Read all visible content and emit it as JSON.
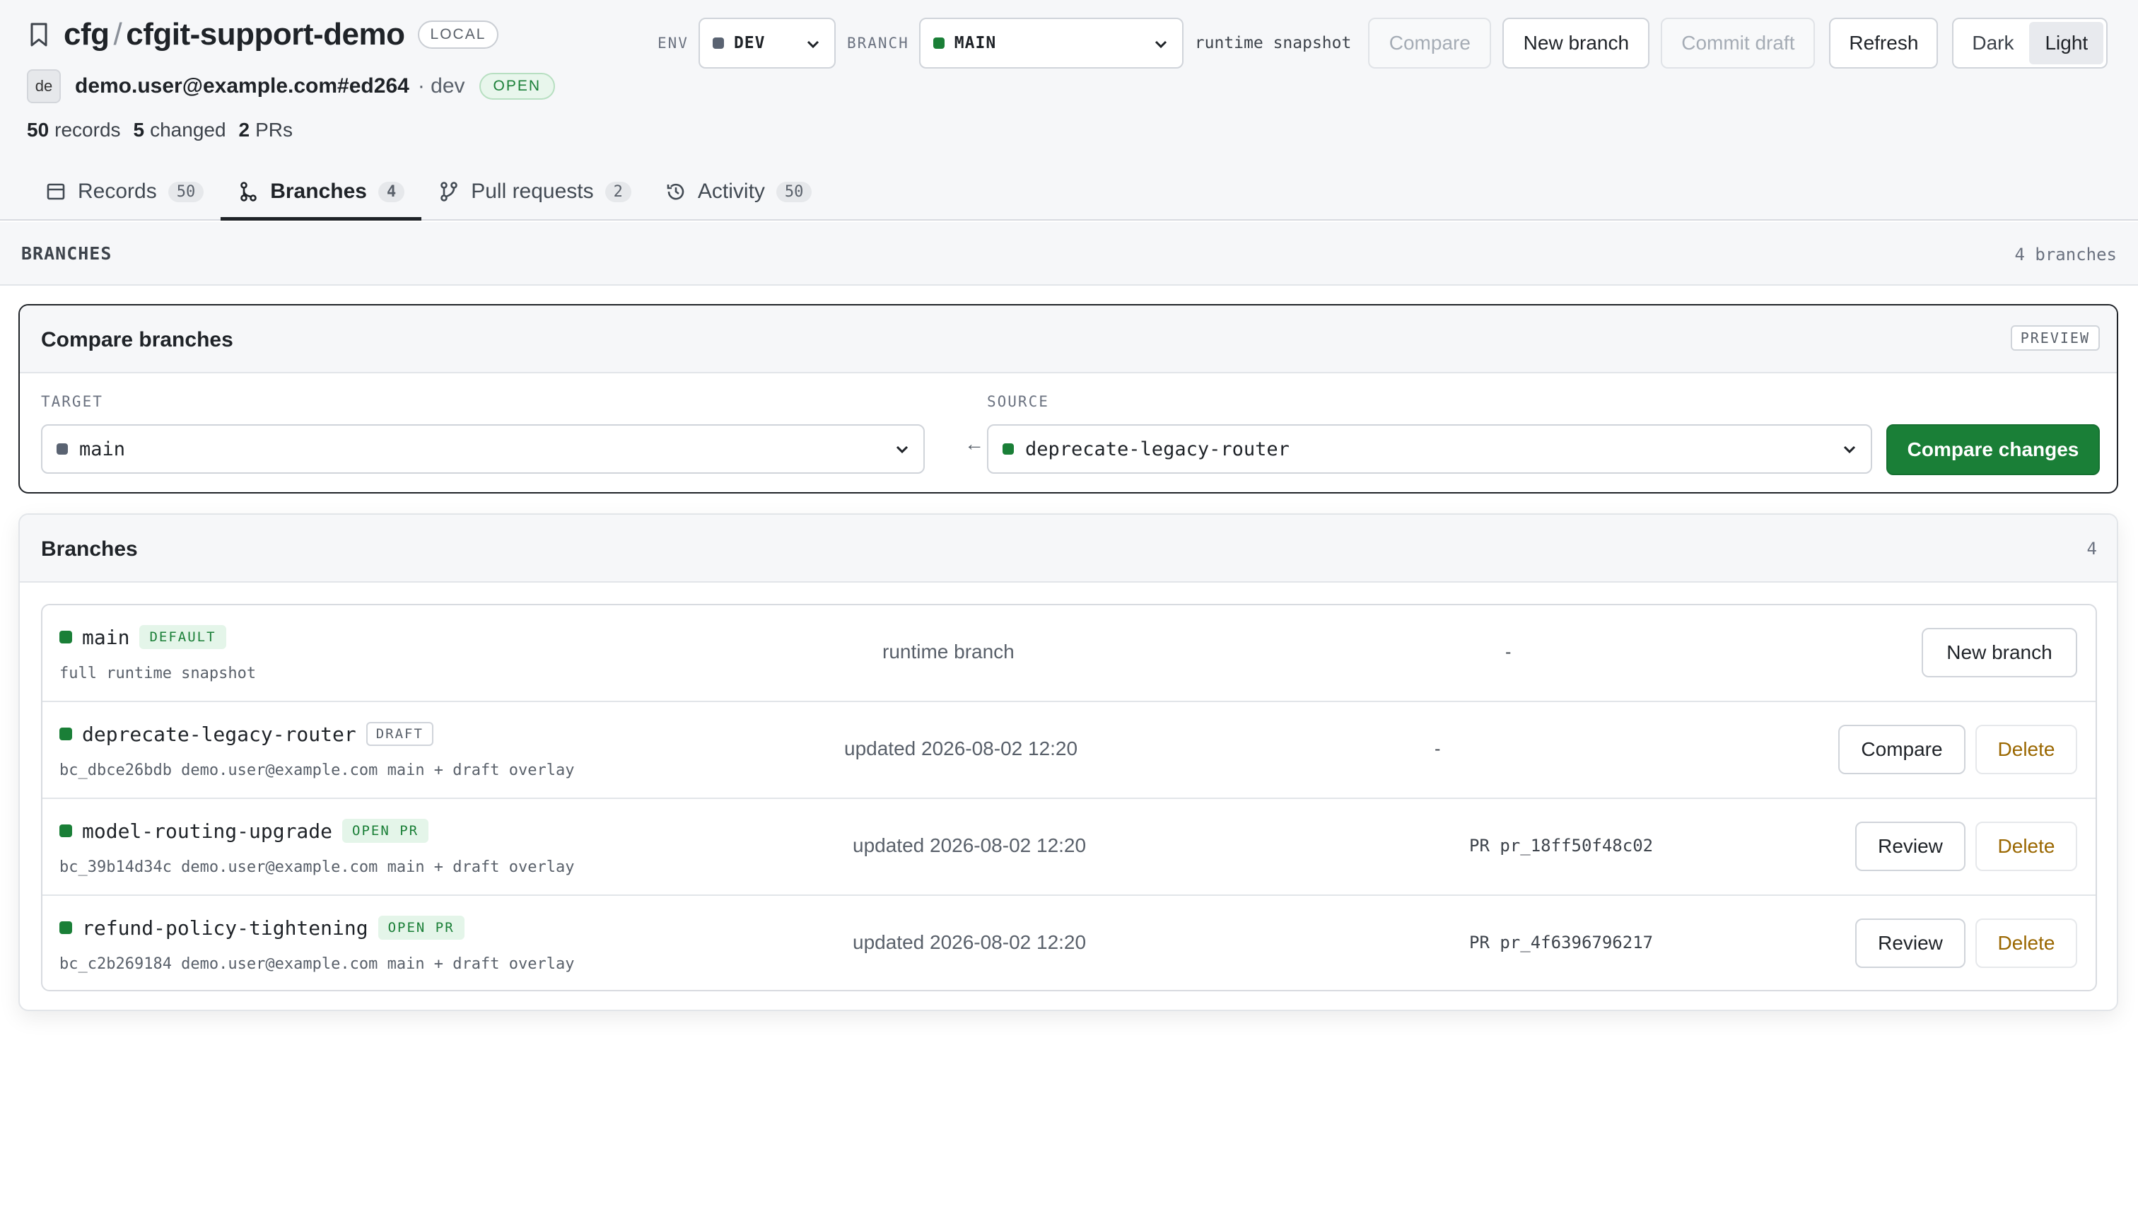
{
  "header": {
    "org": "cfg",
    "separator": "/",
    "repo": "cfgit-support-demo",
    "mode_badge": "LOCAL",
    "user": {
      "initials": "de",
      "email": "demo.user@example.com#ed264",
      "env_suffix": "· dev",
      "status": "OPEN"
    },
    "stats": [
      {
        "value": "50",
        "label": "records"
      },
      {
        "value": "5",
        "label": "changed"
      },
      {
        "value": "2",
        "label": "PRs"
      }
    ],
    "controls": {
      "env_label": "ENV",
      "env_value": "DEV",
      "branch_label": "BRANCH",
      "branch_value": "MAIN",
      "snapshot_text": "runtime snapshot",
      "compare": "Compare",
      "new_branch": "New branch",
      "commit_draft": "Commit draft",
      "refresh": "Refresh",
      "theme_dark": "Dark",
      "theme_light": "Light"
    },
    "tabs": [
      {
        "label": "Records",
        "count": "50"
      },
      {
        "label": "Branches",
        "count": "4"
      },
      {
        "label": "Pull requests",
        "count": "2"
      },
      {
        "label": "Activity",
        "count": "50"
      }
    ]
  },
  "section": {
    "title": "BRANCHES",
    "count": "4 branches"
  },
  "compare": {
    "title": "Compare branches",
    "badge": "PREVIEW",
    "target_label": "TARGET",
    "target_value": "main",
    "arrow": "←",
    "source_label": "SOURCE",
    "source_value": "deprecate-legacy-router",
    "button": "Compare changes"
  },
  "branches": {
    "title": "Branches",
    "count": "4",
    "rows": [
      {
        "name": "main",
        "badge": "DEFAULT",
        "sub": "full runtime snapshot",
        "updated": "runtime branch",
        "pr": "-",
        "actions": [
          "New branch"
        ]
      },
      {
        "name": "deprecate-legacy-router",
        "badge": "DRAFT",
        "sub": "bc_dbce26bdb  demo.user@example.com  main + draft overlay",
        "updated": "updated 2026-08-02 12:20",
        "pr": "-",
        "actions": [
          "Compare",
          "Delete"
        ]
      },
      {
        "name": "model-routing-upgrade",
        "badge": "OPEN PR",
        "sub": "bc_39b14d34c  demo.user@example.com  main + draft overlay",
        "updated": "updated 2026-08-02 12:20",
        "pr": "PR pr_18ff50f48c02",
        "actions": [
          "Review",
          "Delete"
        ]
      },
      {
        "name": "refund-policy-tightening",
        "badge": "OPEN PR",
        "sub": "bc_c2b269184  demo.user@example.com  main + draft overlay",
        "updated": "updated 2026-08-02 12:20",
        "pr": "PR pr_4f6396796217",
        "actions": [
          "Review",
          "Delete"
        ]
      }
    ]
  },
  "colors": {
    "accent_green": "#1a7f37",
    "env_dot": "#5a6372",
    "delete_text": "#9a6700"
  },
  "icons": {
    "bookmark": "bookmark-icon",
    "records": "table-icon",
    "branches": "branch-icon",
    "pull_requests": "pull-request-icon",
    "activity": "history-icon",
    "chevron": "chevron-down-icon"
  }
}
